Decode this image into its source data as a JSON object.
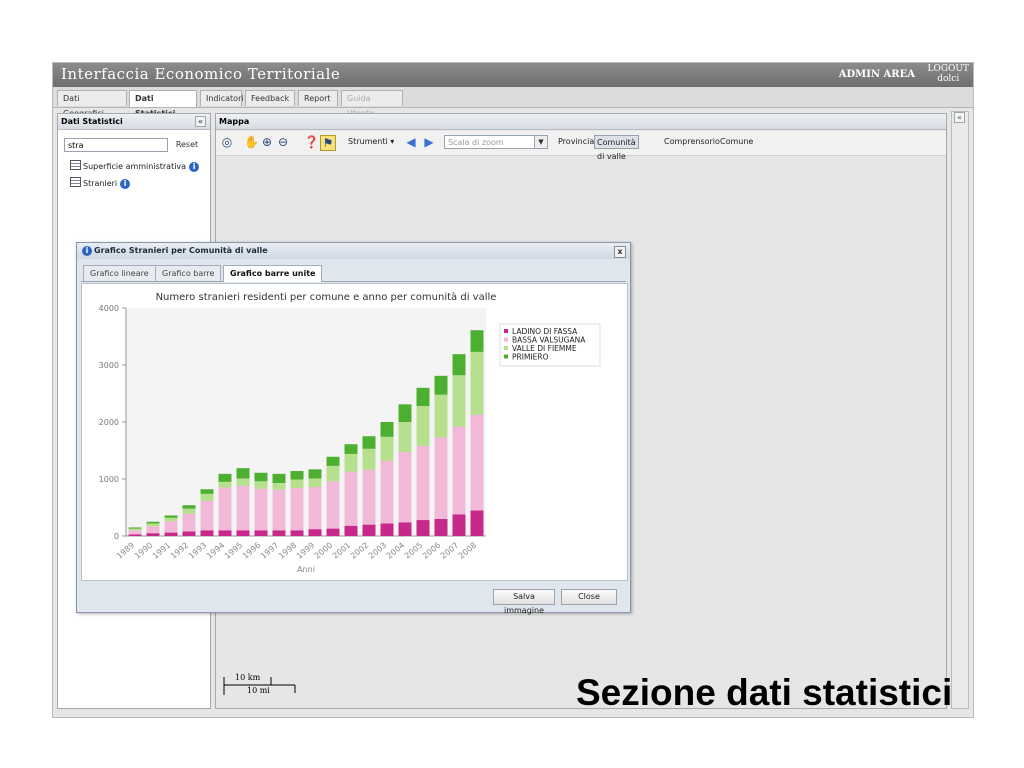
{
  "app": {
    "title": "Interfaccia Economico Territoriale",
    "admin_area": "ADMIN AREA",
    "logout": "LOGOUT",
    "user": "dolci"
  },
  "tabs": [
    {
      "label": "Dati Geografici",
      "active": false
    },
    {
      "label": "Dati Statistici",
      "active": true
    },
    {
      "label": "Indicatori",
      "active": false
    },
    {
      "label": "Feedback",
      "active": false
    },
    {
      "label": "Report",
      "active": false
    },
    {
      "label": "Guida Utente",
      "active": false,
      "disabled": true
    }
  ],
  "left_panel": {
    "title": "Dati Statistici",
    "collapse": "«",
    "search": {
      "value": "stra",
      "reset_label": "Reset"
    },
    "items": [
      {
        "label": "Superficie amministrativa",
        "info": "i"
      },
      {
        "label": "Stranieri",
        "info": "i"
      }
    ]
  },
  "map_panel": {
    "title": "Mappa",
    "tools_label": "Strumenti",
    "zoom_placeholder": "Scala di zoom",
    "levels": [
      {
        "label": "Provincia",
        "active": false
      },
      {
        "label": "Comunità di valle",
        "active": true
      },
      {
        "label": "Comprensorio",
        "active": false
      },
      {
        "label": "Comune",
        "active": false
      }
    ],
    "right_collapse": "«",
    "scale": {
      "km": "10 km",
      "mi": "10 mi"
    }
  },
  "popup": {
    "title": "Grafico Stranieri per Comunità di valle",
    "close": "x",
    "tabs": [
      {
        "label": "Grafico lineare",
        "active": false
      },
      {
        "label": "Grafico barre",
        "active": false
      },
      {
        "label": "Grafico barre unite",
        "active": true
      }
    ],
    "buttons": {
      "save": "Salva immagine",
      "close": "Close"
    }
  },
  "caption": "Sezione dati statistici",
  "colors": {
    "ladino": "#c8288a",
    "bassa": "#f2b8d8",
    "fiemme": "#b6e08e",
    "primiero": "#4caf2f",
    "map_fill": "#f9cf92",
    "map_border": "#c9371f"
  },
  "chart_data": {
    "type": "bar",
    "stacked": true,
    "title": "Numero stranieri residenti per comune e anno per comunità di valle",
    "xlabel": "Anni",
    "ylabel": "",
    "ylim": [
      0,
      4000
    ],
    "yticks": [
      0,
      1000,
      2000,
      3000,
      4000
    ],
    "categories": [
      "1989",
      "1990",
      "1991",
      "1992",
      "1993",
      "1994",
      "1995",
      "1996",
      "1997",
      "1998",
      "1999",
      "2000",
      "2001",
      "2002",
      "2003",
      "2004",
      "2005",
      "2006",
      "2007",
      "2008"
    ],
    "legend_position": "top-right",
    "series": [
      {
        "name": "LADINO DI FASSA",
        "color": "#c8288a",
        "values": [
          30,
          50,
          60,
          80,
          100,
          100,
          100,
          100,
          100,
          100,
          120,
          130,
          180,
          200,
          220,
          240,
          280,
          300,
          380,
          450
        ]
      },
      {
        "name": "BASSA VALSUGANA",
        "color": "#f2b8d8",
        "values": [
          70,
          120,
          200,
          310,
          520,
          750,
          780,
          730,
          710,
          740,
          740,
          830,
          950,
          960,
          1100,
          1230,
          1300,
          1430,
          1540,
          1680
        ]
      },
      {
        "name": "VALLE DI FIEMME",
        "color": "#b6e08e",
        "values": [
          30,
          50,
          60,
          90,
          120,
          100,
          130,
          130,
          120,
          150,
          150,
          270,
          310,
          370,
          420,
          530,
          700,
          750,
          900,
          1100
        ]
      },
      {
        "name": "PRIMIERO",
        "color": "#4caf2f",
        "values": [
          20,
          30,
          40,
          60,
          80,
          140,
          180,
          150,
          160,
          150,
          160,
          160,
          170,
          220,
          260,
          310,
          320,
          330,
          370,
          380
        ]
      }
    ]
  }
}
